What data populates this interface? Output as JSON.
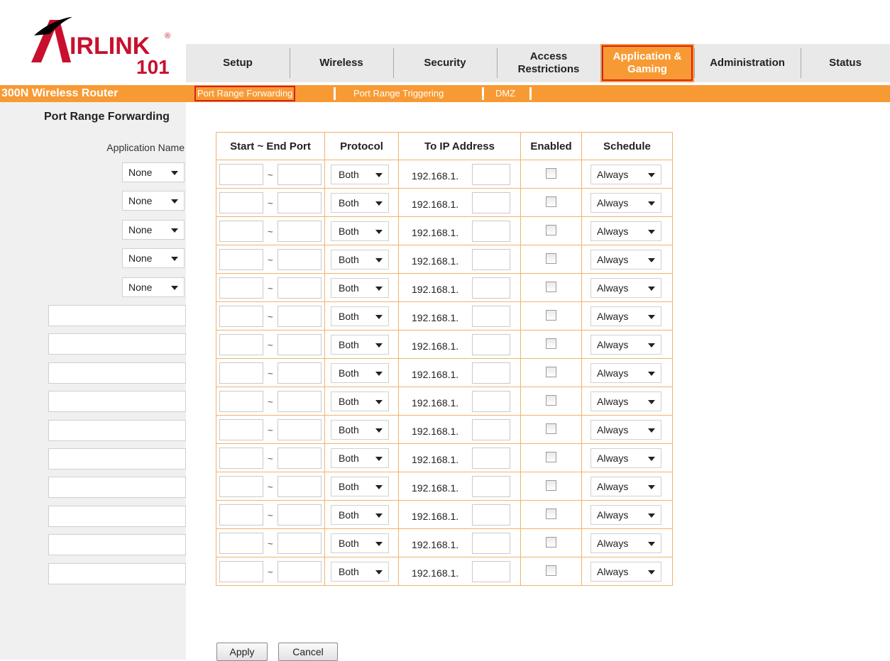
{
  "brand": {
    "logo_top": "IRLINK",
    "logo_bottom": "101",
    "product": "300N Wireless Router"
  },
  "nav": {
    "tabs": [
      {
        "label": "Setup",
        "active": false
      },
      {
        "label": "Wireless",
        "active": false
      },
      {
        "label": "Security",
        "active": false
      },
      {
        "label": "Access\nRestrictions",
        "active": false
      },
      {
        "label": "Application &\nGaming",
        "active": true
      },
      {
        "label": "Administration",
        "active": false
      },
      {
        "label": "Status",
        "active": false
      }
    ]
  },
  "subnav": {
    "items": [
      "Port Range Forwarding",
      "Port Range Triggering",
      "DMZ"
    ],
    "active": "Port Range Forwarding"
  },
  "section_title": "Port Range Forwarding",
  "table": {
    "headers": {
      "app_name": "Application Name",
      "ports": "Start ~ End Port",
      "protocol": "Protocol",
      "ip": "To IP Address",
      "enabled": "Enabled",
      "schedule": "Schedule"
    },
    "separator": "~",
    "ip_prefix": "192.168.1.",
    "rows": [
      {
        "app": "None",
        "protocol": "Both",
        "schedule": "Always",
        "enabled": false
      },
      {
        "app": "None",
        "protocol": "Both",
        "schedule": "Always",
        "enabled": false
      },
      {
        "app": "None",
        "protocol": "Both",
        "schedule": "Always",
        "enabled": false
      },
      {
        "app": "None",
        "protocol": "Both",
        "schedule": "Always",
        "enabled": false
      },
      {
        "app": "None",
        "protocol": "Both",
        "schedule": "Always",
        "enabled": false
      },
      {
        "app": "",
        "protocol": "Both",
        "schedule": "Always",
        "enabled": false
      },
      {
        "app": "",
        "protocol": "Both",
        "schedule": "Always",
        "enabled": false
      },
      {
        "app": "",
        "protocol": "Both",
        "schedule": "Always",
        "enabled": false
      },
      {
        "app": "",
        "protocol": "Both",
        "schedule": "Always",
        "enabled": false
      },
      {
        "app": "",
        "protocol": "Both",
        "schedule": "Always",
        "enabled": false
      },
      {
        "app": "",
        "protocol": "Both",
        "schedule": "Always",
        "enabled": false
      },
      {
        "app": "",
        "protocol": "Both",
        "schedule": "Always",
        "enabled": false
      },
      {
        "app": "",
        "protocol": "Both",
        "schedule": "Always",
        "enabled": false
      },
      {
        "app": "",
        "protocol": "Both",
        "schedule": "Always",
        "enabled": false
      },
      {
        "app": "",
        "protocol": "Both",
        "schedule": "Always",
        "enabled": false
      }
    ]
  },
  "buttons": {
    "apply": "Apply",
    "cancel": "Cancel"
  },
  "colors": {
    "accent": "#f89a33",
    "highlight": "#d62020",
    "table_border": "#f2b26f",
    "sidebar": "#f0f0f0",
    "logo_red": "#c8102e"
  }
}
